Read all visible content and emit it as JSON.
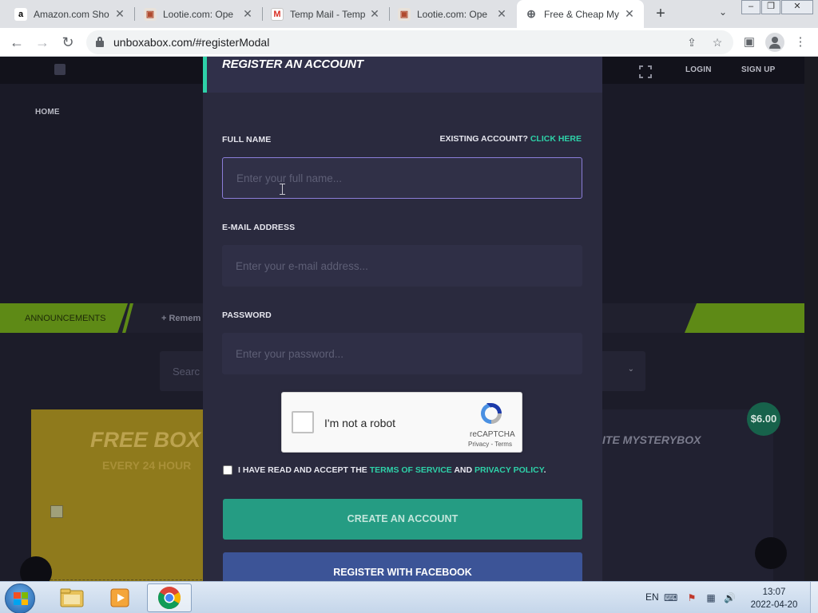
{
  "browser": {
    "tabs": [
      {
        "title": "Amazon.com Sho",
        "favicon": "a"
      },
      {
        "title": "Lootie.com: Ope",
        "favicon": "box"
      },
      {
        "title": "Temp Mail - Temp",
        "favicon": "M"
      },
      {
        "title": "Lootie.com: Ope",
        "favicon": "box"
      },
      {
        "title": "Free & Cheap My",
        "favicon": "globe"
      }
    ],
    "url": "unboxabox.com/#registerModal"
  },
  "site": {
    "nav": {
      "login": "LOGIN",
      "signup": "SIGN UP",
      "home": "HOME"
    },
    "announcements": {
      "label": "ANNOUNCEMENTS",
      "text": "+ Remem"
    },
    "search_placeholder": "Searc",
    "free_box": {
      "title": "FREE BOX",
      "subtitle": "EVERY 24 HOUR"
    },
    "elite_box": {
      "title": "ITE MYSTERYBOX",
      "price": "$6.00"
    }
  },
  "modal": {
    "title": "REGISTER AN ACCOUNT",
    "full_name": {
      "label": "FULL NAME",
      "placeholder": "Enter your full name..."
    },
    "existing_account": {
      "text": "EXISTING ACCOUNT?",
      "link": "CLICK HERE"
    },
    "email": {
      "label": "E-MAIL ADDRESS",
      "placeholder": "Enter your e-mail address..."
    },
    "password": {
      "label": "PASSWORD",
      "placeholder": "Enter your password..."
    },
    "recaptcha": {
      "text": "I'm not a robot",
      "brand": "reCAPTCHA",
      "links": "Privacy - Terms"
    },
    "agree": {
      "prefix": "I HAVE READ AND ACCEPT THE",
      "tos": "TERMS OF SERVICE",
      "and": "AND",
      "privacy": "PRIVACY POLICY",
      "suffix": "."
    },
    "create_button": "CREATE AN ACCOUNT",
    "facebook_button": "REGISTER WITH FACEBOOK"
  },
  "taskbar": {
    "language": "EN",
    "time": "13:07",
    "date": "2022-04-20"
  },
  "colors": {
    "accent": "#2ed1a8",
    "create_button": "#259c83",
    "facebook_button": "#3c5497",
    "announcement_green": "#5e8a16"
  }
}
